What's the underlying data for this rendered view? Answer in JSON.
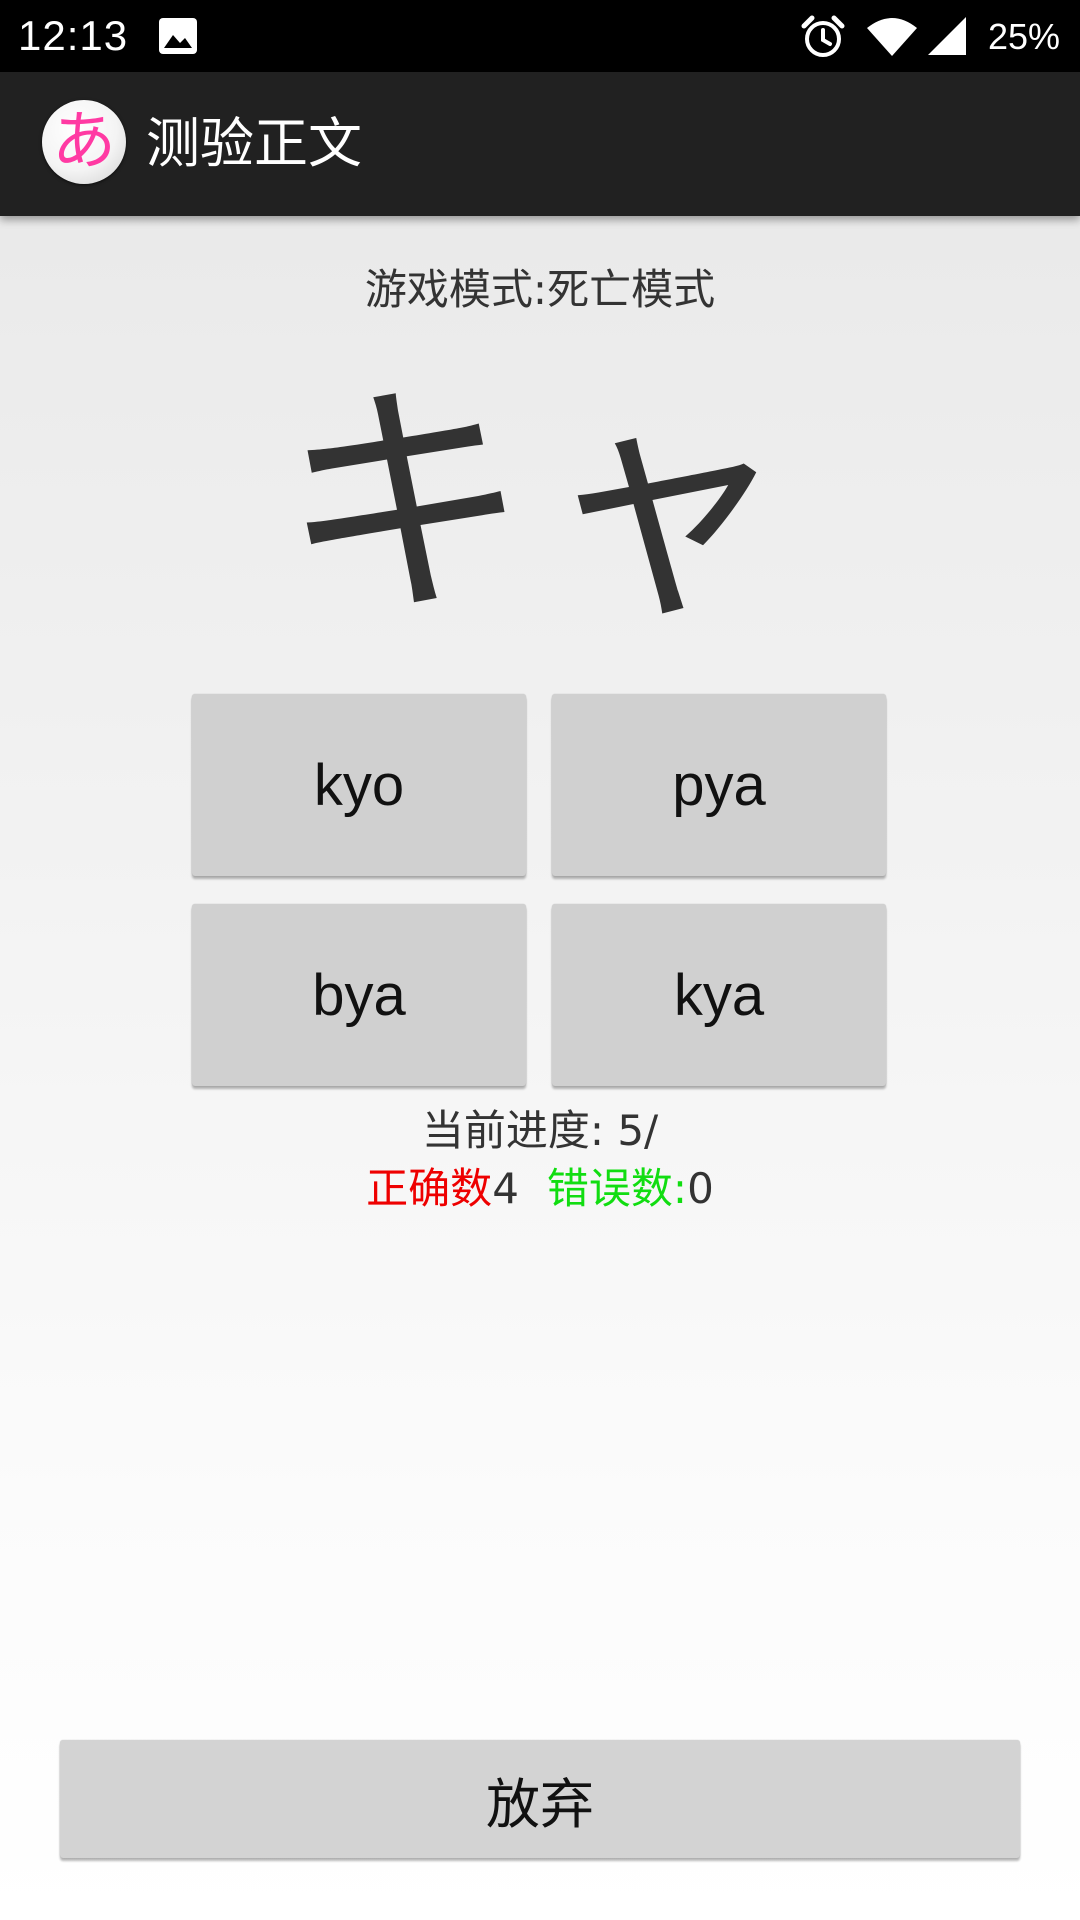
{
  "status_bar": {
    "time": "12:13",
    "battery": "25%",
    "icons": [
      "image-icon",
      "alarm-icon",
      "wifi-icon",
      "signal-icon"
    ]
  },
  "app_bar": {
    "logo_glyph": "あ",
    "title": "测验正文"
  },
  "quiz": {
    "mode_label": "游戏模式:死亡模式",
    "kana": "キャ",
    "options": [
      "kyo",
      "pya",
      "bya",
      "kya"
    ],
    "progress_label": "当前进度: 5/",
    "correct_label": "正确数",
    "correct_value": "4",
    "wrong_label": "错误数:",
    "wrong_value": "0"
  },
  "give_up_label": "放弃",
  "colors": {
    "status_bar": "#000000",
    "app_bar": "#212121",
    "logo_glyph": "#ff3aa3",
    "correct": "#ee0000",
    "wrong": "#11dd11",
    "button": "#d0d0d0"
  }
}
